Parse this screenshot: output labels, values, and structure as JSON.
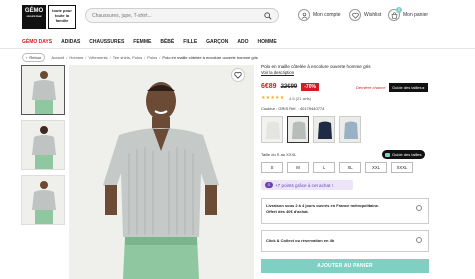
{
  "header": {
    "logo_text": "GÉMO",
    "logo_sub": "GROUPE ÉRAM",
    "tagline": "toute pour toute la famille",
    "search_placeholder": "Chaussures, jupe, T-shirt...",
    "account_label": "Mon compte",
    "wishlist_label": "Wishlist",
    "cart_label": "Mon panier",
    "cart_count": "0"
  },
  "nav": {
    "items": [
      "GÉMO DAYS",
      "ADIDAS",
      "CHAUSSURES",
      "FEMME",
      "BÉBÉ",
      "FILLE",
      "GARÇON",
      "ADO",
      "HOMME"
    ]
  },
  "breadcrumb": {
    "back_label": "Retour",
    "items": [
      "Accueil",
      "Homme",
      "Vêtements",
      "Tee shirts, Polos",
      "Polos",
      "Polo en maille côtelée à encolure ouverte homme gris"
    ]
  },
  "product": {
    "title": "Polo en maille côtelée à encolure ouverte homme gris",
    "desc_link": "Voir la description",
    "price_now": "6€89",
    "price_old": "22€99",
    "discount": "-70%",
    "last_chance": "Dernière chance",
    "guide_badge": "Guide des tailles ▸",
    "stars": "★★★★★",
    "rating": "4.5 (21 avis)",
    "color_line": "Couleur : GRIS   Réf. : 40179440774",
    "size_label": "Taille du S au XXXL",
    "size_guide": "Guide des tailles",
    "sizes": [
      "S",
      "M",
      "L",
      "XL",
      "XXL",
      "XXXL"
    ],
    "loyalty": "+7 points grâce à cet achat !",
    "delivery_line1": "Livraison sous 2 à 4 jours ouvrés en France métropolitaine.",
    "delivery_line2": "Offert dès 40€ d'achat.",
    "pickup_line": "Click & Collect ou réservation en 4h",
    "add_to_cart": "AJOUTER AU PANIER"
  },
  "colors": {
    "brand_red": "#d71920",
    "cart_button": "#7fd0c2",
    "loyalty_purple": "#6b3fb3",
    "star": "#f2b01e"
  }
}
